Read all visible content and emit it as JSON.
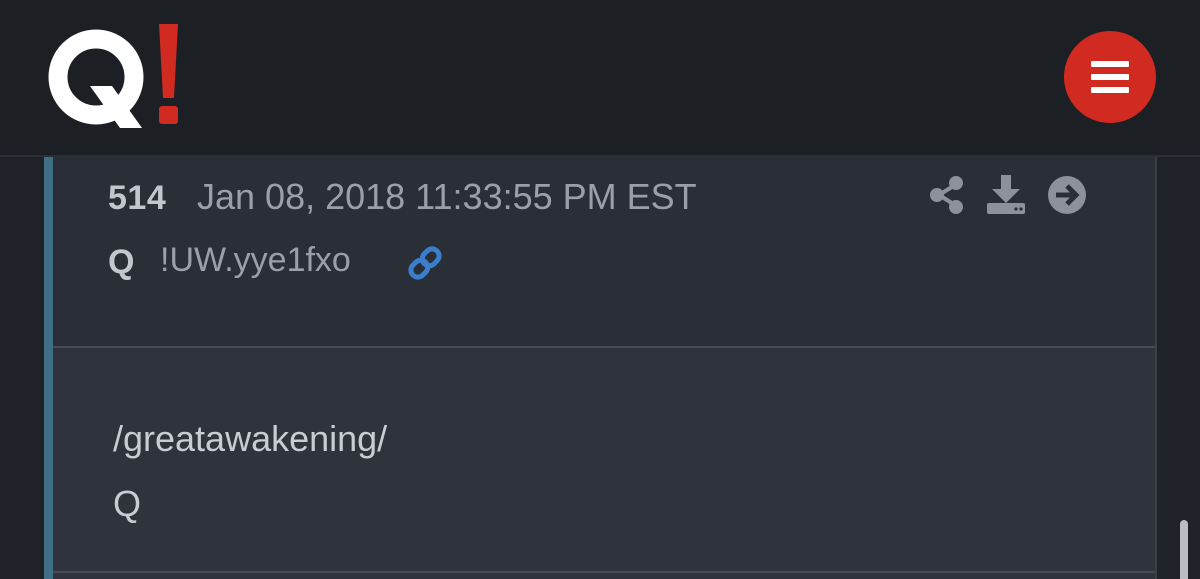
{
  "header": {
    "logo_alt": "Q!",
    "menu_icon": "hamburger-menu-icon",
    "brand_color": "#d12a21"
  },
  "post": {
    "number": "514",
    "datetime": "Jan 08, 2018 11:33:55 PM EST",
    "author": "Q",
    "tripcode": "!UW.yye1fxo",
    "link_icon": "link-icon",
    "actions": [
      "share-icon",
      "download-icon",
      "arrow-right-circle-icon"
    ],
    "body_lines": [
      "/greatawakening/",
      "Q"
    ],
    "accent_color": "#3f6f86",
    "link_color": "#3b7ecb"
  }
}
